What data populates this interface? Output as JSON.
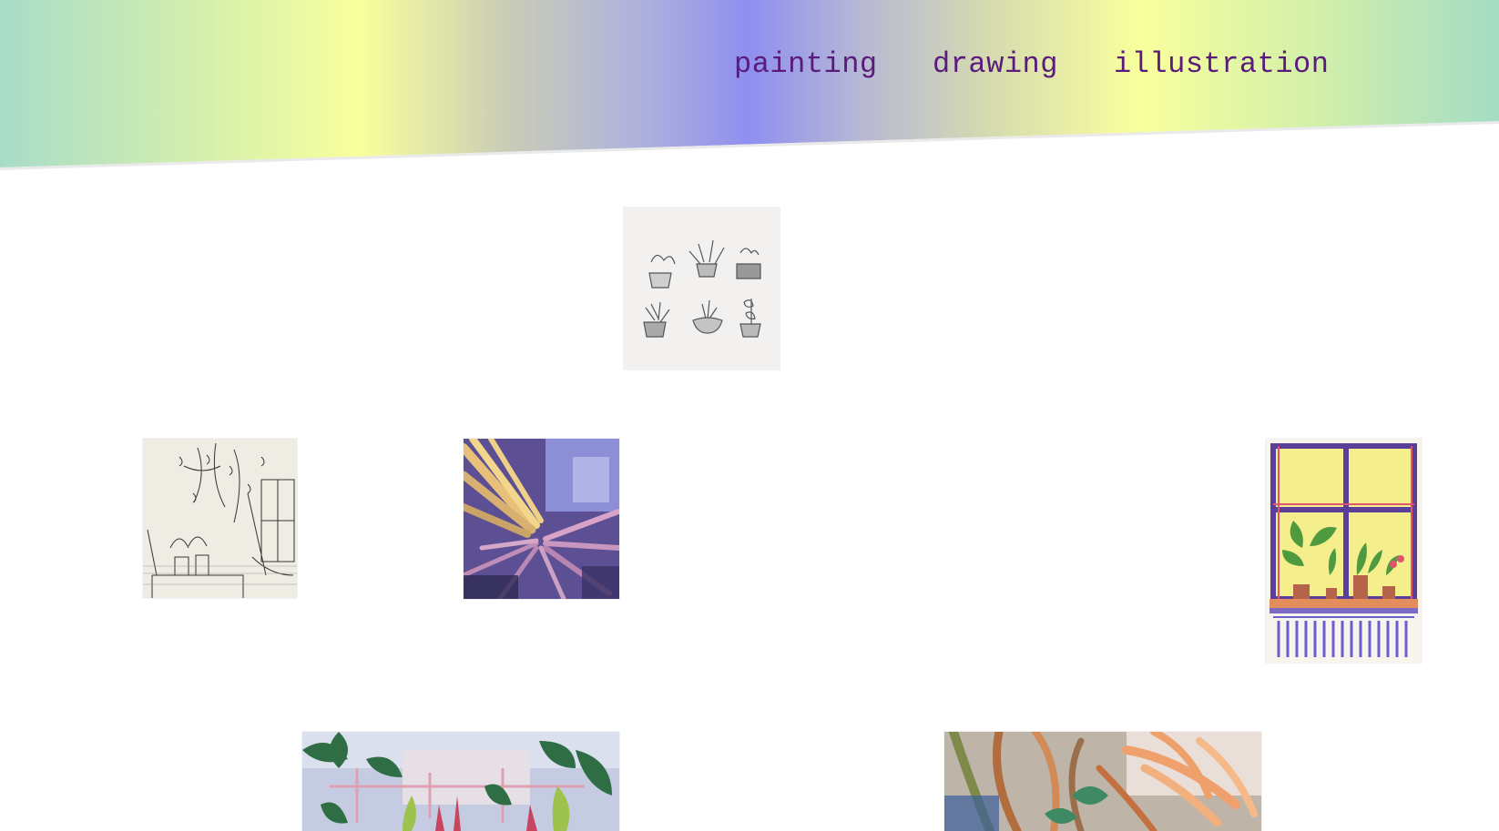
{
  "nav": {
    "painting": "painting",
    "drawing": "drawing",
    "illustration": "illustration"
  },
  "colors": {
    "nav_text": "#5a1b7c",
    "gradient_teal": "#a8dcc8",
    "gradient_yellow": "#f8ff9c",
    "gradient_violet": "#8f8ff0"
  },
  "gallery": [
    {
      "kind": "pencil drawing of six potted plants"
    },
    {
      "kind": "ink drawing of plants by a window"
    },
    {
      "kind": "painting of purple and yellow palm leaves"
    },
    {
      "kind": "marker illustration of a window with potted plants"
    },
    {
      "kind": "painting of tropical leaves with pale sky"
    },
    {
      "kind": "painting of orange palm fronds"
    }
  ]
}
